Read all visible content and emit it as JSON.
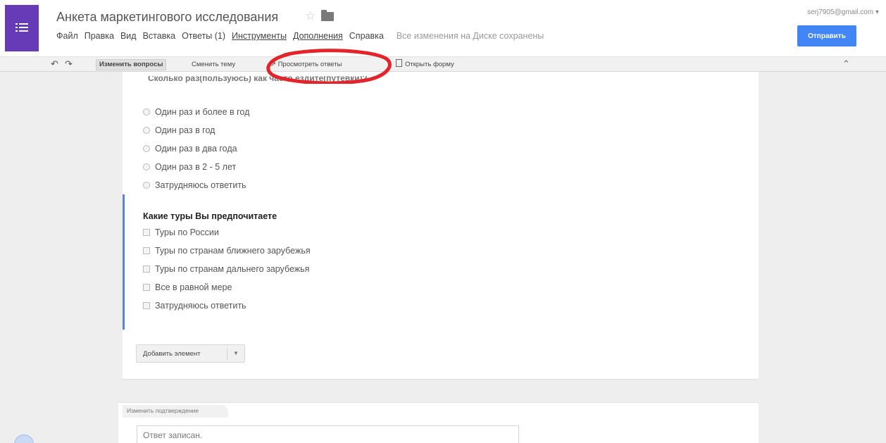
{
  "header": {
    "title": "Анкета маркетингового исследования",
    "account": "serj7905@gmail.com ▾",
    "send_label": "Отправить",
    "save_status": "Все изменения на Диске сохранены"
  },
  "menu": [
    {
      "label": "Файл"
    },
    {
      "label": "Правка"
    },
    {
      "label": "Вид"
    },
    {
      "label": "Вставка"
    },
    {
      "label": "Ответы (1)"
    },
    {
      "label": "Инструменты"
    },
    {
      "label": "Дополнения"
    },
    {
      "label": "Справка"
    }
  ],
  "toolbar": {
    "edit_questions": "Изменить вопросы",
    "change_theme": "Сменить тему",
    "view_responses": "↗ Просмотреть ответы",
    "open_form": "Открыть форму"
  },
  "question1": {
    "cut_heading": "Сколько раз(пользуюсь) как часто ездите(путевки)?",
    "options": [
      "Один раз и более в год",
      "Один раз в год",
      "Один раз в два года",
      "Один раз в 2 - 5 лет",
      "Затрудняюсь ответить"
    ]
  },
  "question2": {
    "title": "Какие туры Вы предпочитаете",
    "options": [
      "Туры по России",
      "Туры по странам ближнего зарубежья",
      "Туры по странам дальнего зарубежья",
      "Все в равной мере",
      "Затрудняюсь ответить"
    ]
  },
  "add_element_label": "Добавить элемент",
  "confirmation": {
    "tab_label": "Изменить подтверждение",
    "value": "Ответ записан."
  },
  "colors": {
    "app_tile": "#673ab7",
    "send_button": "#4285f4",
    "question_accent": "#5c85d6",
    "annotation": "#e3242b"
  }
}
